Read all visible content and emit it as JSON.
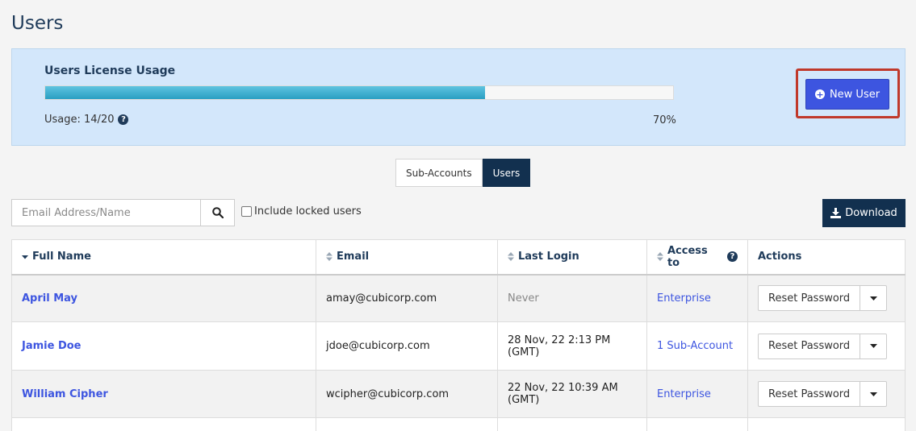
{
  "page": {
    "title": "Users"
  },
  "license": {
    "title": "Users License Usage",
    "usage_label": "Usage: 14/20",
    "percent_label": "70%",
    "progress": 0.7,
    "new_user_label": "New User"
  },
  "tabs": [
    {
      "label": "Sub-Accounts",
      "active": false
    },
    {
      "label": "Users",
      "active": true
    }
  ],
  "search": {
    "placeholder": "Email Address/Name",
    "value": ""
  },
  "locked_filter": {
    "label": "Include locked users",
    "checked": false
  },
  "download": {
    "label": "Download"
  },
  "table": {
    "columns": [
      {
        "label": "Full Name",
        "sort": "desc"
      },
      {
        "label": "Email",
        "sort": "none"
      },
      {
        "label": "Last Login",
        "sort": "none"
      },
      {
        "label": "Access to",
        "sort": "none",
        "help": true
      },
      {
        "label": "Actions",
        "sort": null
      }
    ],
    "rows": [
      {
        "name": "April May",
        "email": "amay@cubicorp.com",
        "last_login": "Never",
        "access": "Enterprise",
        "action": "Reset Password"
      },
      {
        "name": "Jamie Doe",
        "email": "jdoe@cubicorp.com",
        "last_login": "28 Nov, 22 2:13 PM (GMT)",
        "access": "1 Sub-Account",
        "action": "Reset Password"
      },
      {
        "name": "William Cipher",
        "email": "wcipher@cubicorp.com",
        "last_login": "22 Nov, 22 10:39 AM (GMT)",
        "access": "Enterprise",
        "action": "Reset Password"
      }
    ]
  },
  "colors": {
    "accent": "#3d55e0",
    "navy": "#12304f",
    "panel": "#d3e7fb",
    "highlight": "#c0392b"
  }
}
